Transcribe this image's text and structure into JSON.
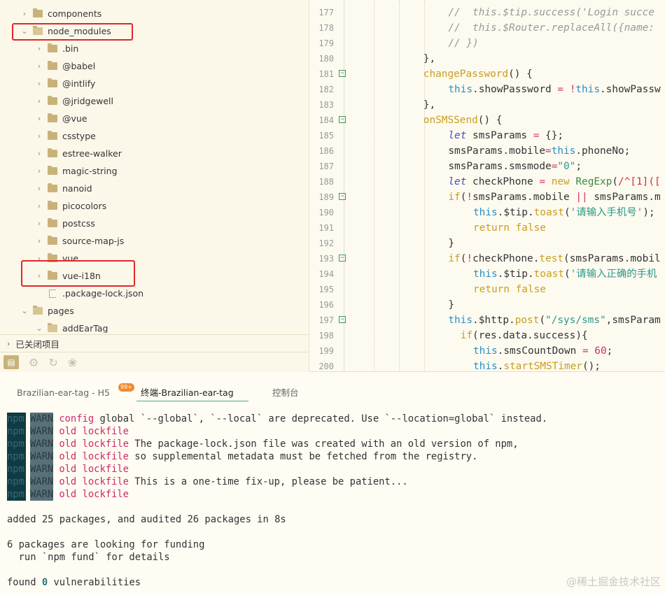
{
  "tree": [
    {
      "label": "components",
      "level": 1,
      "type": "folder",
      "expanded": false
    },
    {
      "label": "node_modules",
      "level": 1,
      "type": "folder",
      "expanded": true
    },
    {
      "label": ".bin",
      "level": 2,
      "type": "folder",
      "expanded": false
    },
    {
      "label": "@babel",
      "level": 2,
      "type": "folder",
      "expanded": false
    },
    {
      "label": "@intlify",
      "level": 2,
      "type": "folder",
      "expanded": false
    },
    {
      "label": "@jridgewell",
      "level": 2,
      "type": "folder",
      "expanded": false
    },
    {
      "label": "@vue",
      "level": 2,
      "type": "folder",
      "expanded": false
    },
    {
      "label": "csstype",
      "level": 2,
      "type": "folder",
      "expanded": false
    },
    {
      "label": "estree-walker",
      "level": 2,
      "type": "folder",
      "expanded": false
    },
    {
      "label": "magic-string",
      "level": 2,
      "type": "folder",
      "expanded": false
    },
    {
      "label": "nanoid",
      "level": 2,
      "type": "folder",
      "expanded": false
    },
    {
      "label": "picocolors",
      "level": 2,
      "type": "folder",
      "expanded": false
    },
    {
      "label": "postcss",
      "level": 2,
      "type": "folder",
      "expanded": false
    },
    {
      "label": "source-map-js",
      "level": 2,
      "type": "folder",
      "expanded": false
    },
    {
      "label": "vue",
      "level": 2,
      "type": "folder",
      "expanded": false
    },
    {
      "label": "vue-i18n",
      "level": 2,
      "type": "folder",
      "expanded": false
    },
    {
      "label": ".package-lock.json",
      "level": 2,
      "type": "file"
    },
    {
      "label": "pages",
      "level": 1,
      "type": "folder",
      "expanded": true
    },
    {
      "label": "addEarTag",
      "level": 2,
      "type": "folder",
      "expanded": true
    }
  ],
  "closed_projects": "已关闭项目",
  "code": [
    {
      "n": 177,
      "i": 4,
      "s": [
        [
          "cm",
          "//  this.$tip.success('Login succe"
        ]
      ]
    },
    {
      "n": 178,
      "i": 4,
      "s": [
        [
          "cm",
          "//  this.$Router.replaceAll({name:"
        ]
      ]
    },
    {
      "n": 179,
      "i": 4,
      "s": [
        [
          "cm",
          "// })"
        ]
      ]
    },
    {
      "n": 180,
      "i": 3,
      "s": [
        [
          "",
          "},"
        ]
      ]
    },
    {
      "n": 181,
      "i": 3,
      "f": true,
      "s": [
        [
          "fn",
          "changePassword"
        ],
        [
          "",
          "() {"
        ]
      ]
    },
    {
      "n": 182,
      "i": 4,
      "s": [
        [
          "th",
          "this"
        ],
        [
          "",
          ".showPassword "
        ],
        [
          "op",
          "="
        ],
        [
          "",
          " "
        ],
        [
          "op",
          "!"
        ],
        [
          "th",
          "this"
        ],
        [
          "",
          ".showPassw"
        ]
      ]
    },
    {
      "n": 183,
      "i": 3,
      "s": [
        [
          "",
          "},"
        ]
      ]
    },
    {
      "n": 184,
      "i": 3,
      "f": true,
      "s": [
        [
          "fn",
          "onSMSSend"
        ],
        [
          "",
          "() {"
        ]
      ]
    },
    {
      "n": 185,
      "i": 4,
      "s": [
        [
          "kw",
          "let"
        ],
        [
          "",
          " smsParams "
        ],
        [
          "op",
          "="
        ],
        [
          "",
          " {};"
        ]
      ]
    },
    {
      "n": 186,
      "i": 4,
      "s": [
        [
          "",
          "smsParams.mobile"
        ],
        [
          "op",
          "="
        ],
        [
          "th",
          "this"
        ],
        [
          "",
          ".phoneNo;"
        ]
      ]
    },
    {
      "n": 187,
      "i": 4,
      "s": [
        [
          "",
          "smsParams.smsmode"
        ],
        [
          "op",
          "="
        ],
        [
          "st",
          "\"0\""
        ],
        [
          "",
          ";"
        ]
      ]
    },
    {
      "n": 188,
      "i": 4,
      "s": [
        [
          "kw",
          "let"
        ],
        [
          "",
          " checkPhone "
        ],
        [
          "op",
          "="
        ],
        [
          "",
          " "
        ],
        [
          "kw2",
          "new"
        ],
        [
          "",
          " "
        ],
        [
          "cls",
          "RegExp"
        ],
        [
          "",
          "("
        ],
        [
          "rg",
          "/^[1](["
        ]
      ]
    },
    {
      "n": 189,
      "i": 4,
      "f": true,
      "s": [
        [
          "kw2",
          "if"
        ],
        [
          "",
          "("
        ],
        [
          "op",
          "!"
        ],
        [
          "",
          "smsParams.mobile "
        ],
        [
          "op",
          "||"
        ],
        [
          "",
          " smsParams.m"
        ]
      ]
    },
    {
      "n": 190,
      "i": 5,
      "s": [
        [
          "th",
          "this"
        ],
        [
          "",
          ".$tip."
        ],
        [
          "fn",
          "toast"
        ],
        [
          "",
          "("
        ],
        [
          "st",
          "'请输入手机号'"
        ],
        [
          "",
          ");"
        ]
      ]
    },
    {
      "n": 191,
      "i": 5,
      "s": [
        [
          "kw2",
          "return false"
        ]
      ]
    },
    {
      "n": 192,
      "i": 4,
      "s": [
        [
          "",
          "}"
        ]
      ]
    },
    {
      "n": 193,
      "i": 4,
      "f": true,
      "s": [
        [
          "kw2",
          "if"
        ],
        [
          "",
          "("
        ],
        [
          "op",
          "!"
        ],
        [
          "",
          "checkPhone."
        ],
        [
          "fn",
          "test"
        ],
        [
          "",
          "(smsParams.mobil"
        ]
      ]
    },
    {
      "n": 194,
      "i": 5,
      "s": [
        [
          "th",
          "this"
        ],
        [
          "",
          ".$tip."
        ],
        [
          "fn",
          "toast"
        ],
        [
          "",
          "("
        ],
        [
          "st",
          "'请输入正确的手机"
        ]
      ]
    },
    {
      "n": 195,
      "i": 5,
      "s": [
        [
          "kw2",
          "return false"
        ]
      ]
    },
    {
      "n": 196,
      "i": 4,
      "s": [
        [
          "",
          "}"
        ]
      ]
    },
    {
      "n": 197,
      "i": 4,
      "f": true,
      "s": [
        [
          "th",
          "this"
        ],
        [
          "",
          ".$http."
        ],
        [
          "fn",
          "post"
        ],
        [
          "",
          "("
        ],
        [
          "st",
          "\"/sys/sms\""
        ],
        [
          "",
          ",smsParam"
        ]
      ]
    },
    {
      "n": 198,
      "i": 4,
      "s": [
        [
          "",
          "  "
        ],
        [
          "kw2",
          "if"
        ],
        [
          "",
          "(res.data.success){"
        ]
      ]
    },
    {
      "n": 199,
      "i": 5,
      "s": [
        [
          "th",
          "this"
        ],
        [
          "",
          ".smsCountDown "
        ],
        [
          "op",
          "="
        ],
        [
          "",
          " "
        ],
        [
          "nu",
          "60"
        ],
        [
          "",
          ";"
        ]
      ]
    },
    {
      "n": 200,
      "i": 5,
      "s": [
        [
          "th",
          "this"
        ],
        [
          "",
          "."
        ],
        [
          "fn",
          "startSMSTimer"
        ],
        [
          "",
          "();"
        ]
      ]
    }
  ],
  "tabs": [
    {
      "label": "Brazilian-ear-tag - H5",
      "badge": "99+"
    },
    {
      "label": "终端-Brazilian-ear-tag",
      "active": true
    },
    {
      "label": "控制台"
    }
  ],
  "terminal": {
    "npm": "npm",
    "warn": "WARN",
    "warn_lines": [
      {
        "tag": "config",
        "text": " global `--global`, `--local` are deprecated. Use `--location=global` instead."
      },
      {
        "tag": "old lockfile",
        "text": ""
      },
      {
        "tag": "old lockfile",
        "text": " The package-lock.json file was created with an old version of npm,"
      },
      {
        "tag": "old lockfile",
        "text": " so supplemental metadata must be fetched from the registry."
      },
      {
        "tag": "old lockfile",
        "text": ""
      },
      {
        "tag": "old lockfile",
        "text": " This is a one-time fix-up, please be patient..."
      },
      {
        "tag": "old lockfile",
        "text": ""
      }
    ],
    "added": "added 25 packages, and audited 26 packages in 8s",
    "funding": "6 packages are looking for funding",
    "fund_hint": "  run `npm fund` for details",
    "found_prefix": "found ",
    "found_count": "0",
    "found_suffix": " vulnerabilities"
  },
  "watermark": "@稀土掘金技术社区"
}
